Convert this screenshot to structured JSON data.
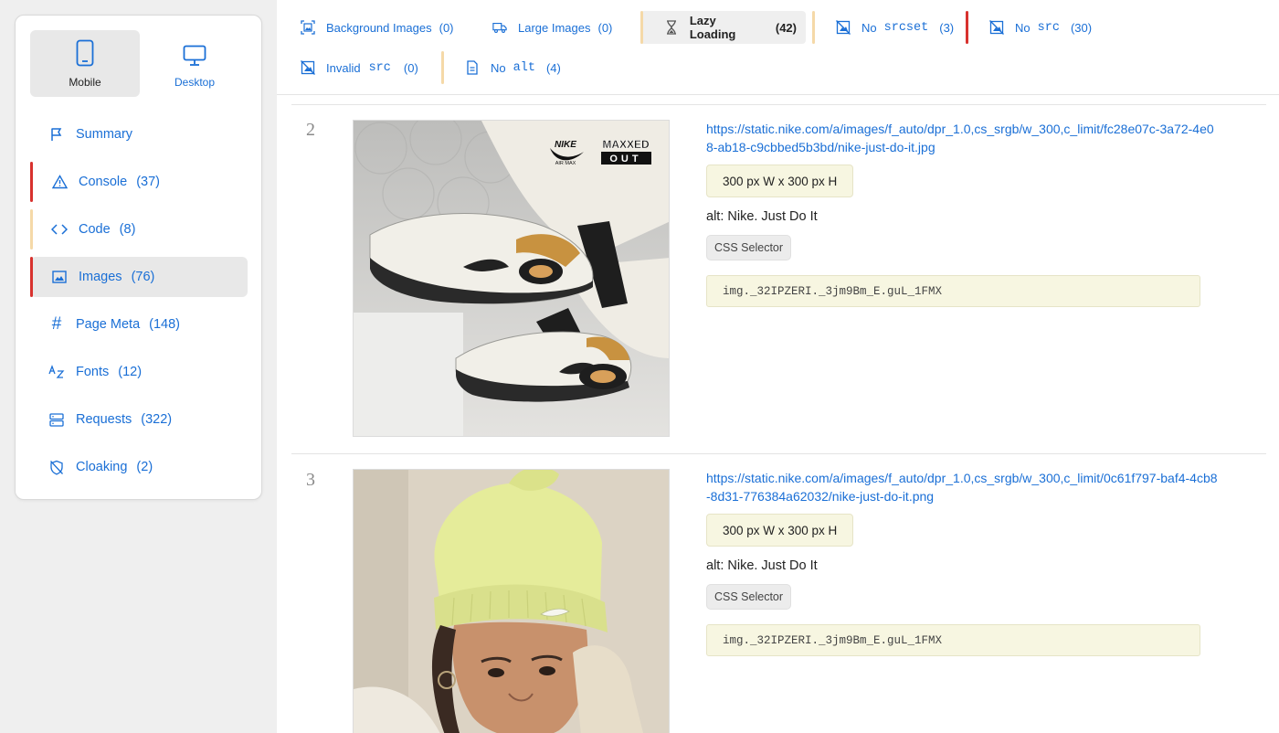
{
  "device_toggle": {
    "mobile_label": "Mobile",
    "desktop_label": "Desktop"
  },
  "nav": {
    "items": [
      {
        "label": "Summary",
        "count": ""
      },
      {
        "label": "Console",
        "count": "(37)"
      },
      {
        "label": "Code",
        "count": "(8)"
      },
      {
        "label": "Images",
        "count": "(76)"
      },
      {
        "label": "Page Meta",
        "count": "(148)"
      },
      {
        "label": "Fonts",
        "count": "(12)"
      },
      {
        "label": "Requests",
        "count": "(322)"
      },
      {
        "label": "Cloaking",
        "count": "(2)"
      }
    ]
  },
  "filters": {
    "background_images": {
      "label": "Background Images",
      "count": "(0)"
    },
    "large_images": {
      "label": "Large Images",
      "count": "(0)"
    },
    "lazy_loading": {
      "label": "Lazy Loading",
      "count": "(42)"
    },
    "no_srcset": {
      "prefix": "No",
      "code": "srcset",
      "count": "(3)"
    },
    "no_src": {
      "prefix": "No",
      "code": "src",
      "count": "(30)"
    },
    "invalid_src": {
      "prefix": "Invalid",
      "code": "src",
      "count": "(0)"
    },
    "no_alt": {
      "prefix": "No",
      "code": "alt",
      "count": "(4)"
    }
  },
  "colors": {
    "accent": "#1a6fd6",
    "error_bar": "#d8322e",
    "warning_bar": "#f5d9a8",
    "highlight_bg": "#f7f6e1"
  },
  "images": [
    {
      "index": "2",
      "url": "https://static.nike.com/a/images/f_auto/dpr_1.0,cs_srgb/w_300,c_limit/fc28e07c-3a72-4e08-ab18-c9cbbed5b3bd/nike-just-do-it.jpg",
      "dimensions": "300 px W x 300 px H",
      "alt": "alt: Nike. Just Do It",
      "css_selector_label": "CSS Selector",
      "selector": "img._32IPZERI._3jm9Bm_E.guL_1FMX",
      "logo_nike": "NIKE",
      "logo_airmax": "AIR MAX",
      "logo_maxxed": "MAXXED",
      "logo_out": "OUT"
    },
    {
      "index": "3",
      "url": "https://static.nike.com/a/images/f_auto/dpr_1.0,cs_srgb/w_300,c_limit/0c61f797-baf4-4cb8-8d31-776384a62032/nike-just-do-it.png",
      "dimensions": "300 px W x 300 px H",
      "alt": "alt: Nike. Just Do It",
      "css_selector_label": "CSS Selector",
      "selector": "img._32IPZERI._3jm9Bm_E.guL_1FMX"
    }
  ]
}
